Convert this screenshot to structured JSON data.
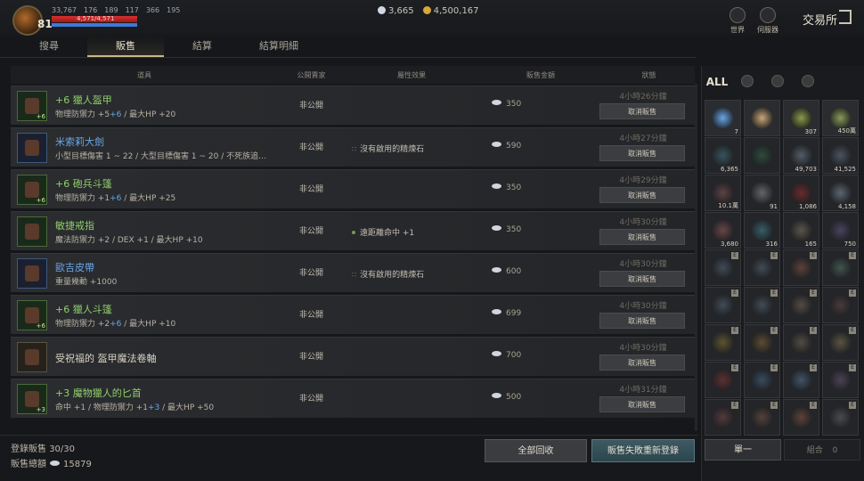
{
  "player": {
    "level": "81",
    "stats": [
      "33,767",
      "176",
      "189",
      "117",
      "366",
      "195"
    ],
    "hp_text": "4,571/4,571",
    "hp_fraction": 1.0,
    "mp_fraction": 1.0
  },
  "currency": {
    "crystals": "3,665",
    "gold": "4,500,167"
  },
  "top_nav": {
    "world": "世界",
    "server": "伺服器",
    "title": "交易所"
  },
  "tabs": [
    "搜尋",
    "販售",
    "結算",
    "結算明細"
  ],
  "table": {
    "headers": [
      "道具",
      "公開賣家",
      "屬性效果",
      "販售金額",
      "狀態"
    ],
    "rows": [
      {
        "name": "+6 獵人盔甲",
        "quality": "green",
        "sub": "物理防禦力 +5",
        "sub_hl": "+6",
        "sub_tail": " / 最大HP +20",
        "public": "非公開",
        "attr": "",
        "attr_kind": "",
        "price": "350",
        "time": "4小時26分鐘",
        "cancel": "取消販售",
        "enchant": "+6"
      },
      {
        "name": "米索莉大劍",
        "quality": "blue",
        "sub": "小型目標傷害 1 ~ 22 / 大型目標傷害 1 ~ 20 / 不死族追加...",
        "sub_hl": "",
        "sub_tail": "",
        "public": "非公開",
        "attr": "沒有啟用的精煉石",
        "attr_kind": "none",
        "price": "590",
        "time": "4小時27分鐘",
        "cancel": "取消販售",
        "enchant": ""
      },
      {
        "name": "+6 砲兵斗篷",
        "quality": "green",
        "sub": "物理防禦力 +1",
        "sub_hl": "+6",
        "sub_tail": " / 最大HP +25",
        "public": "非公開",
        "attr": "",
        "attr_kind": "",
        "price": "350",
        "time": "4小時29分鐘",
        "cancel": "取消販售",
        "enchant": "+6"
      },
      {
        "name": "敏捷戒指",
        "quality": "green",
        "sub": "魔法防禦力 +2 / DEX +1 / 最大HP +10",
        "sub_hl": "",
        "sub_tail": "",
        "public": "非公開",
        "attr": "遠距離命中 +1",
        "attr_kind": "dot",
        "price": "350",
        "time": "4小時30分鐘",
        "cancel": "取消販售",
        "enchant": ""
      },
      {
        "name": "歐吉皮帶",
        "quality": "blue",
        "sub": "重量幾動 +1000",
        "sub_hl": "",
        "sub_tail": "",
        "public": "非公開",
        "attr": "沒有啟用的精煉石",
        "attr_kind": "none",
        "price": "600",
        "time": "4小時30分鐘",
        "cancel": "取消販售",
        "enchant": ""
      },
      {
        "name": "+6 獵人斗篷",
        "quality": "green",
        "sub": "物理防禦力 +2",
        "sub_hl": "+6",
        "sub_tail": " / 最大HP +10",
        "public": "非公開",
        "attr": "",
        "attr_kind": "",
        "price": "699",
        "time": "4小時30分鐘",
        "cancel": "取消販售",
        "enchant": "+6"
      },
      {
        "name": "受祝福的 盔甲魔法卷軸",
        "quality": "white",
        "sub": "",
        "sub_hl": "",
        "sub_tail": "",
        "public": "非公開",
        "attr": "",
        "attr_kind": "",
        "price": "700",
        "time": "4小時30分鐘",
        "cancel": "取消販售",
        "enchant": ""
      },
      {
        "name": "+3 魔物獵人的匕首",
        "quality": "green",
        "sub": "命中 +1 / 物理防禦力 +1",
        "sub_hl": "+3",
        "sub_tail": " / 最大HP +50",
        "public": "非公開",
        "attr": "",
        "attr_kind": "",
        "price": "500",
        "time": "4小時31分鐘",
        "cancel": "取消販售",
        "enchant": "+3"
      }
    ]
  },
  "bottom": {
    "registered_label": "登錄販售",
    "registered_value": "30/30",
    "total_label": "販售總額",
    "total_value": "15879",
    "recall_button": "全部回收",
    "relist_button": "販售失敗重新登錄"
  },
  "inventory": {
    "filter_all": "ALL",
    "single_button": "單一",
    "combine_button": "組合",
    "combine_count": "0",
    "slots": [
      {
        "count": "7",
        "lit": true,
        "color": "#6aa6e8"
      },
      {
        "count": "",
        "lit": true,
        "color": "#c9a878"
      },
      {
        "count": "307",
        "lit": true,
        "color": "#8a9a4a"
      },
      {
        "count": "450萬",
        "lit": true,
        "color": "#8a9a5a"
      },
      {
        "count": "6,365",
        "lit": false,
        "color": "#4a7a8a"
      },
      {
        "count": "",
        "lit": false,
        "color": "#3a6a4a"
      },
      {
        "count": "49,703",
        "lit": false,
        "color": "#7a8a9a"
      },
      {
        "count": "41,525",
        "lit": false,
        "color": "#6a7a8a"
      },
      {
        "count": "10.1萬",
        "lit": false,
        "color": "#8a5a5a"
      },
      {
        "count": "91",
        "lit": false,
        "color": "#9a9a9a"
      },
      {
        "count": "1,086",
        "lit": false,
        "color": "#a03030"
      },
      {
        "count": "4,158",
        "lit": false,
        "color": "#8a9aaa"
      },
      {
        "count": "3,680",
        "lit": false,
        "color": "#a06060"
      },
      {
        "count": "316",
        "lit": false,
        "color": "#4a8a9a"
      },
      {
        "count": "165",
        "lit": false,
        "color": "#8a7a6a"
      },
      {
        "count": "750",
        "lit": false,
        "color": "#6a5a8a"
      },
      {
        "count": "",
        "lit": false,
        "color": "#5a6a7a",
        "e": true
      },
      {
        "count": "",
        "lit": false,
        "color": "#5a6a7a",
        "e": true
      },
      {
        "count": "",
        "lit": false,
        "color": "#8a5a4a",
        "e": true
      },
      {
        "count": "",
        "lit": false,
        "color": "#5a7a6a",
        "e": true
      },
      {
        "count": "",
        "lit": false,
        "color": "#5a6a7a",
        "e": true
      },
      {
        "count": "",
        "lit": false,
        "color": "#5a6a7a",
        "e": true
      },
      {
        "count": "",
        "lit": false,
        "color": "#7a6a5a",
        "e": true
      },
      {
        "count": "",
        "lit": false,
        "color": "#6a4a4a",
        "e": true
      },
      {
        "count": "",
        "lit": false,
        "color": "#8a7a3a",
        "e": true
      },
      {
        "count": "",
        "lit": false,
        "color": "#8a6a3a",
        "e": true
      },
      {
        "count": "",
        "lit": false,
        "color": "#7a6a5a",
        "e": true
      },
      {
        "count": "",
        "lit": false,
        "color": "#8a7a5a",
        "e": true
      },
      {
        "count": "",
        "lit": false,
        "color": "#8a3a3a",
        "e": true
      },
      {
        "count": "",
        "lit": false,
        "color": "#4a6a8a",
        "e": true
      },
      {
        "count": "",
        "lit": false,
        "color": "#5a7a9a",
        "e": true
      },
      {
        "count": "",
        "lit": false,
        "color": "#6a5a7a",
        "e": true
      },
      {
        "count": "",
        "lit": false,
        "color": "#7a4a4a",
        "e": true
      },
      {
        "count": "",
        "lit": false,
        "color": "#7a5a4a",
        "e": true
      },
      {
        "count": "",
        "lit": false,
        "color": "#8a5a4a",
        "e": true
      },
      {
        "count": "",
        "lit": false,
        "color": "#6a6a6a",
        "e": true
      }
    ]
  },
  "colors": {
    "accent": "#c8b78a",
    "green_item": "#8fd06a",
    "blue_item": "#6aa6e8",
    "relist_btn": "#3d5a63"
  }
}
